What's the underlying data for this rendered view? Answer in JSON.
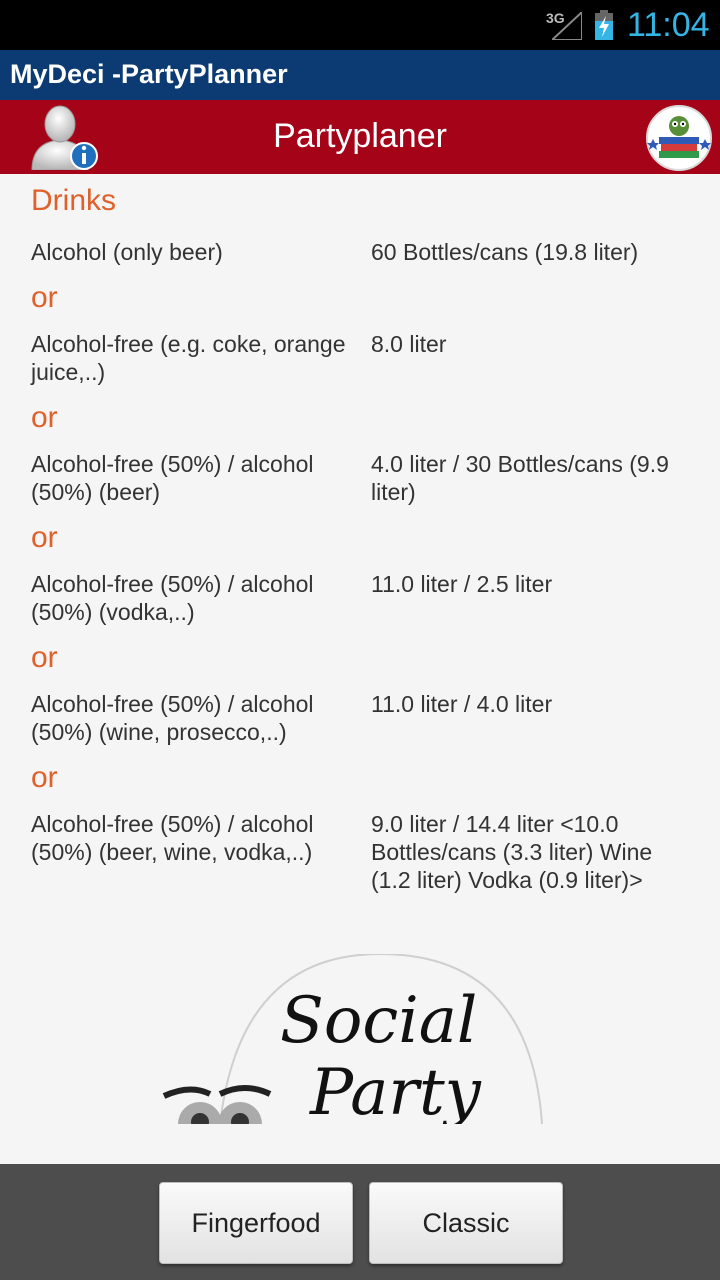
{
  "status_bar": {
    "network": "3G",
    "time": "11:04"
  },
  "app": {
    "title": "MyDeci -PartyPlanner"
  },
  "header": {
    "title": "Partyplaner"
  },
  "icons": {
    "user_info": "user-info-icon",
    "logo": "owl-books-logo-icon"
  },
  "section": {
    "title": "Drinks"
  },
  "separator": "or",
  "rows": [
    {
      "label": "Alcohol (only beer)",
      "value": "60 Bottles/cans (19.8 liter)"
    },
    {
      "label": "Alcohol-free (e.g. coke, orange juice,..)",
      "value": "8.0 liter"
    },
    {
      "label": "Alcohol-free (50%) / alcohol (50%) (beer)",
      "value": "4.0 liter / 30 Bottles/cans (9.9 liter)"
    },
    {
      "label": "Alcohol-free (50%) / alcohol (50%) (vodka,..)",
      "value": "11.0 liter / 2.5 liter"
    },
    {
      "label": "Alcohol-free (50%) / alcohol (50%) (wine, prosecco,..)",
      "value": "11.0 liter / 4.0 liter"
    },
    {
      "label": "Alcohol-free (50%) / alcohol (50%) (beer, wine, vodka,..)",
      "value": "9.0 liter / 14.4 liter <10.0 Bottles/cans (3.3 liter) Wine (1.2 liter) Vodka (0.9 liter)>"
    }
  ],
  "social_logo": {
    "line1": "Social",
    "line2": "Party"
  },
  "buttons": {
    "fingerfood": "Fingerfood",
    "classic": "Classic"
  },
  "colors": {
    "accent": "#e0602a",
    "header_red": "#a50418",
    "title_blue": "#0b3b72",
    "clock_blue": "#35b5e5"
  }
}
